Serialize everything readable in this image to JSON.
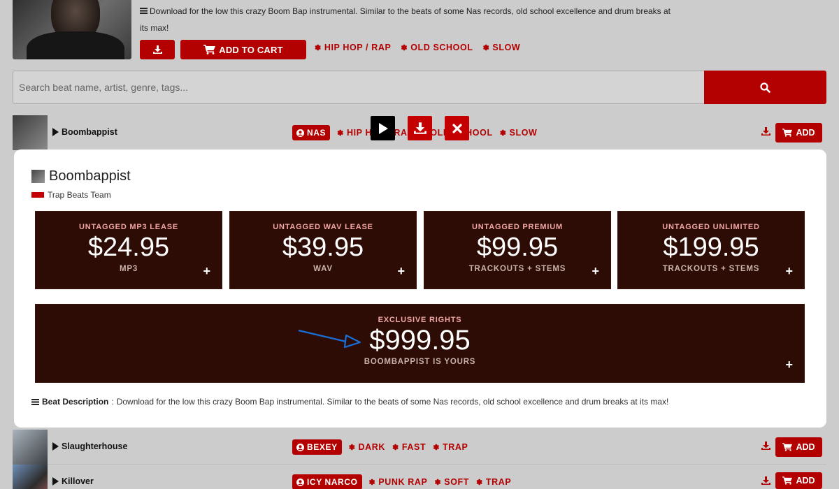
{
  "featured": {
    "description": "Download for the low this crazy Boom Bap instrumental. Similar to the beats of some Nas records, old school excellence and drum breaks at its max!",
    "add_to_cart_label": "ADD TO CART",
    "tags": [
      "HIP HOP / RAP",
      "OLD SCHOOL",
      "SLOW"
    ]
  },
  "search": {
    "placeholder": "Search beat name, artist, genre, tags..."
  },
  "tracks": [
    {
      "title": "Boombappist",
      "artist": "NAS",
      "tags": [
        "HIP HOP / RAP",
        "OLD SCHOOL",
        "SLOW"
      ],
      "add_label": "ADD"
    },
    {
      "title": "Slaughterhouse",
      "artist": "BEXEY",
      "tags": [
        "DARK",
        "FAST",
        "TRAP"
      ],
      "add_label": "ADD"
    },
    {
      "title": "Killover",
      "artist": "ICY NARCO",
      "tags": [
        "PUNK RAP",
        "SOFT",
        "TRAP"
      ],
      "add_label": "ADD"
    }
  ],
  "modal": {
    "title": "Boombappist",
    "producer": "Trap Beats Team",
    "licenses": [
      {
        "name": "UNTAGGED MP3 LEASE",
        "price": "$24.95",
        "files": "MP3"
      },
      {
        "name": "UNTAGGED WAV LEASE",
        "price": "$39.95",
        "files": "WAV"
      },
      {
        "name": "UNTAGGED PREMIUM",
        "price": "$99.95",
        "files": "TRACKOUTS + STEMS"
      },
      {
        "name": "UNTAGGED UNLIMITED",
        "price": "$199.95",
        "files": "TRACKOUTS + STEMS"
      }
    ],
    "exclusive": {
      "name": "EXCLUSIVE RIGHTS",
      "price": "$999.95",
      "files": "BOOMBAPPIST IS YOURS"
    },
    "description_label": "Beat Description",
    "description": "Download for the low this crazy Boom Bap instrumental. Similar to the beats of some Nas records, old school excellence and drum breaks at its max!"
  },
  "colors": {
    "accent": "#b30000",
    "license_bg": "#2c0c04",
    "background": "#cccccc",
    "annotation_arrow": "#1a6fd6"
  },
  "icons": [
    "lines-icon",
    "download-icon",
    "cart-icon",
    "tag-icon",
    "search-icon",
    "play-icon",
    "close-icon",
    "user-icon",
    "plus-icon",
    "arrow-annotation"
  ]
}
